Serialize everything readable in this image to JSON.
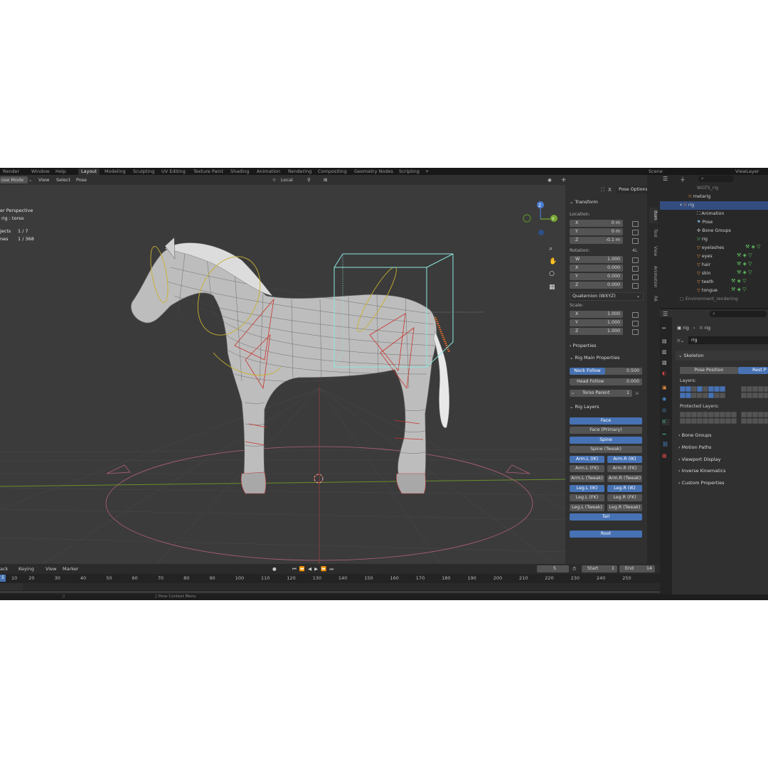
{
  "topbar": {
    "menus": [
      "Render",
      "Window",
      "Help"
    ],
    "workspaces": [
      "Layout",
      "Modeling",
      "Sculpting",
      "UV Editing",
      "Texture Paint",
      "Shading",
      "Animation",
      "Rendering",
      "Compositing",
      "Geometry Nodes",
      "Scripting"
    ],
    "add": "+",
    "scene": "Scene",
    "view_layer": "ViewLayer"
  },
  "viewport": {
    "mode": "ose Mode",
    "menus": [
      "View",
      "Select",
      "Pose"
    ],
    "orientation": "Local",
    "overlay_text": {
      "perspective": "er Perspective",
      "object": "rig : torso",
      "objects_label": "jects",
      "objects_value": "1 / 7",
      "bones_label": "nes",
      "bones_value": "1 / 368"
    },
    "gizmo": {
      "x": "X",
      "y": "Y",
      "z": "Z"
    },
    "pose_options": "Pose Options"
  },
  "npanel": {
    "tabs": [
      "Item",
      "Tool",
      "View",
      "Animation",
      "RA"
    ],
    "transform": {
      "title": "Transform",
      "location_label": "Location:",
      "location": [
        {
          "k": "X",
          "v": "0 m"
        },
        {
          "k": "Y",
          "v": "0 m"
        },
        {
          "k": "Z",
          "v": "-0.1 m"
        }
      ],
      "rotation_label": "Rotation:",
      "rotation_mode_short": "4L",
      "rotation": [
        {
          "k": "W",
          "v": "1.000"
        },
        {
          "k": "X",
          "v": "0.000"
        },
        {
          "k": "Y",
          "v": "0.000"
        },
        {
          "k": "Z",
          "v": "0.000"
        }
      ],
      "rotation_mode": "Quaternion (WXYZ)",
      "scale_label": "Scale:",
      "scale": [
        {
          "k": "X",
          "v": "1.000"
        },
        {
          "k": "Y",
          "v": "1.000"
        },
        {
          "k": "Z",
          "v": "1.000"
        }
      ]
    },
    "properties_title": "Properties",
    "rig_main": {
      "title": "Rig Main Properties",
      "neck_follow": "Neck Follow",
      "neck_follow_value": "0.500",
      "head_follow": "Head Follow",
      "head_follow_value": "0.000",
      "torso_parent": "Torso Parent",
      "torso_parent_value": "1"
    },
    "rig_layers": {
      "title": "Rig Layers",
      "face": "Face",
      "face_primary": "Face (Primary)",
      "spine": "Spine",
      "spine_tweak": "Spine (Tweak)",
      "arm_l_ik": "Arm.L (IK)",
      "arm_r_ik": "Arm.R (IK)",
      "arm_l_fk": "Arm.L (FK)",
      "arm_r_fk": "Arm.R (FK)",
      "arm_l_tweak": "Arm.L (Tweak)",
      "arm_r_tweak": "Arm.R (Tweak)",
      "leg_l_ik": "Leg.L (IK)",
      "leg_r_ik": "Leg.R (IK)",
      "leg_l_fk": "Leg.L (FK)",
      "leg_r_fk": "Leg.R (FK)",
      "leg_l_tweak": "Leg.L (Tweak)",
      "leg_r_tweak": "Leg.R (Tweak)",
      "tail": "Tail",
      "root": "Root"
    }
  },
  "outliner": {
    "items": [
      "WGTS_rig",
      "metarig",
      "rig",
      "Animation",
      "Pose",
      "Bone Groups",
      "rig",
      "eyelashes",
      "eyes",
      "hair",
      "skin",
      "teeth",
      "tongue",
      "Environment_rendering"
    ]
  },
  "properties": {
    "breadcrumb_a": "rig",
    "breadcrumb_b": "rig",
    "armature_name": "rig",
    "skeleton": "Skeleton",
    "pose_position": "Pose Position",
    "rest_position": "Rest P",
    "layers": "Layers:",
    "protected_layers": "Protected Layers:",
    "bone_groups": "Bone Groups",
    "motion_paths": "Motion Paths",
    "viewport_display": "Viewport Display",
    "inverse_kinematics": "Inverse Kinematics",
    "custom_properties": "Custom Properties"
  },
  "timeline": {
    "menus": [
      "ack",
      "Keying",
      "View",
      "Marker"
    ],
    "current_frame": "5",
    "start_label": "Start",
    "start": "1",
    "end_label": "End",
    "end": "14",
    "frame_marker": "5",
    "ticks": [
      "10",
      "20",
      "30",
      "40",
      "50",
      "60",
      "70",
      "80",
      "90",
      "100",
      "110",
      "120",
      "130",
      "140",
      "150",
      "160",
      "170",
      "180",
      "190",
      "200",
      "210",
      "220",
      "230",
      "240",
      "250"
    ]
  },
  "status": {
    "context": "Pose Context Menu"
  },
  "colors": {
    "accent": "#4772b3",
    "selection": "#334d80",
    "viewport_bg": "#3b3b3b",
    "timeline_marker": "#4772b3"
  }
}
